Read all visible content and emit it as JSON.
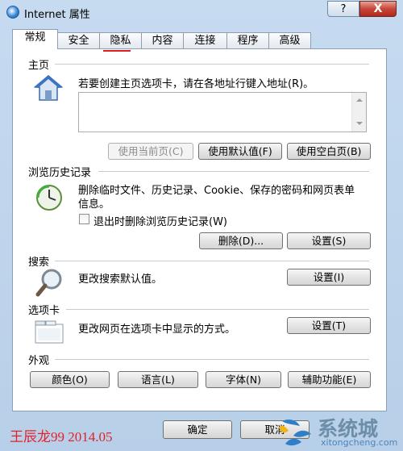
{
  "window": {
    "title": "Internet 属性",
    "help_label": "?",
    "close_label": "X"
  },
  "tabs": [
    {
      "label": "常规",
      "active": true
    },
    {
      "label": "安全"
    },
    {
      "label": "隐私"
    },
    {
      "label": "内容"
    },
    {
      "label": "连接"
    },
    {
      "label": "程序"
    },
    {
      "label": "高级"
    }
  ],
  "home": {
    "section": "主页",
    "instruction": "若要创建主页选项卡，请在各地址行键入地址(R)。",
    "url_value": "",
    "btn_current": "使用当前页(C)",
    "btn_default": "使用默认值(F)",
    "btn_blank": "使用空白页(B)"
  },
  "history": {
    "section": "浏览历史记录",
    "desc_line1": "删除临时文件、历史记录、Cookie、保存的密码和网页表单",
    "desc_line2": "信息。",
    "checkbox_label": "退出时删除浏览历史记录(W)",
    "checkbox_checked": false,
    "btn_delete": "删除(D)...",
    "btn_settings": "设置(S)"
  },
  "search": {
    "section": "搜索",
    "desc": "更改搜索默认值。",
    "btn_settings": "设置(I)"
  },
  "tabs_section": {
    "section": "选项卡",
    "desc": "更改网页在选项卡中显示的方式。",
    "btn_settings": "设置(T)"
  },
  "appearance": {
    "section": "外观",
    "btn_colors": "颜色(O)",
    "btn_languages": "语言(L)",
    "btn_fonts": "字体(N)",
    "btn_accessibility": "辅助功能(E)"
  },
  "footer": {
    "btn_ok": "确定",
    "btn_cancel": "取消"
  },
  "watermark": "王辰龙99 2014.05",
  "logo": {
    "text": "系统城",
    "sub": "xitongcheng.com"
  }
}
